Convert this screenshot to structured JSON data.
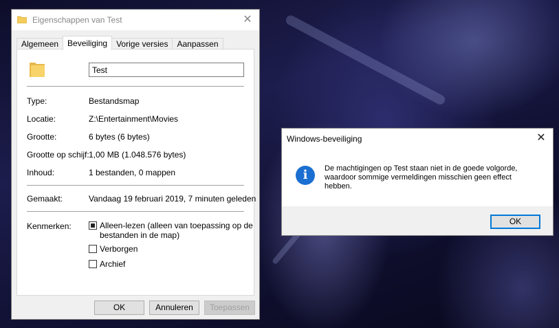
{
  "colors": {
    "accent": "#0078d7",
    "folder": "#f4cc5c",
    "info": "#1a6fd1"
  },
  "properties_window": {
    "title": "Eigenschappen van Test",
    "close_glyph": "✕",
    "tabs": [
      {
        "label": "Algemeen"
      },
      {
        "label": "Beveiliging",
        "active": true
      },
      {
        "label": "Vorige versies"
      },
      {
        "label": "Aanpassen"
      }
    ],
    "name_value": "Test",
    "fields": {
      "type_label": "Type:",
      "type_value": "Bestandsmap",
      "location_label": "Locatie:",
      "location_value": "Z:\\Entertainment\\Movies",
      "size_label": "Grootte:",
      "size_value": "6 bytes (6 bytes)",
      "disk_size_label": "Grootte op schijf:",
      "disk_size_value": "1,00 MB (1.048.576 bytes)",
      "contents_label": "Inhoud:",
      "contents_value": "1 bestanden, 0 mappen",
      "created_label": "Gemaakt:",
      "created_value": "Vandaag 19 februari 2019, 7 minuten geleden"
    },
    "attributes": {
      "label": "Kenmerken:",
      "readonly_line1": "Alleen-lezen (alleen van toepassing op de",
      "readonly_line2": "bestanden in de map)",
      "readonly_checked": "indeterminate",
      "hidden": "Verborgen",
      "archive": "Archief"
    },
    "buttons": {
      "ok": "OK",
      "cancel": "Annuleren",
      "apply": "Toepassen"
    }
  },
  "security_dialog": {
    "title": "Windows-beveiliging",
    "close_glyph": "✕",
    "icon": "info-icon",
    "icon_glyph": "i",
    "message_line1": "De machtigingen op Test staan niet in de goede volgorde,",
    "message_line2": "waardoor sommige vermeldingen misschien geen effect",
    "message_line3": "hebben.",
    "ok": "OK"
  }
}
